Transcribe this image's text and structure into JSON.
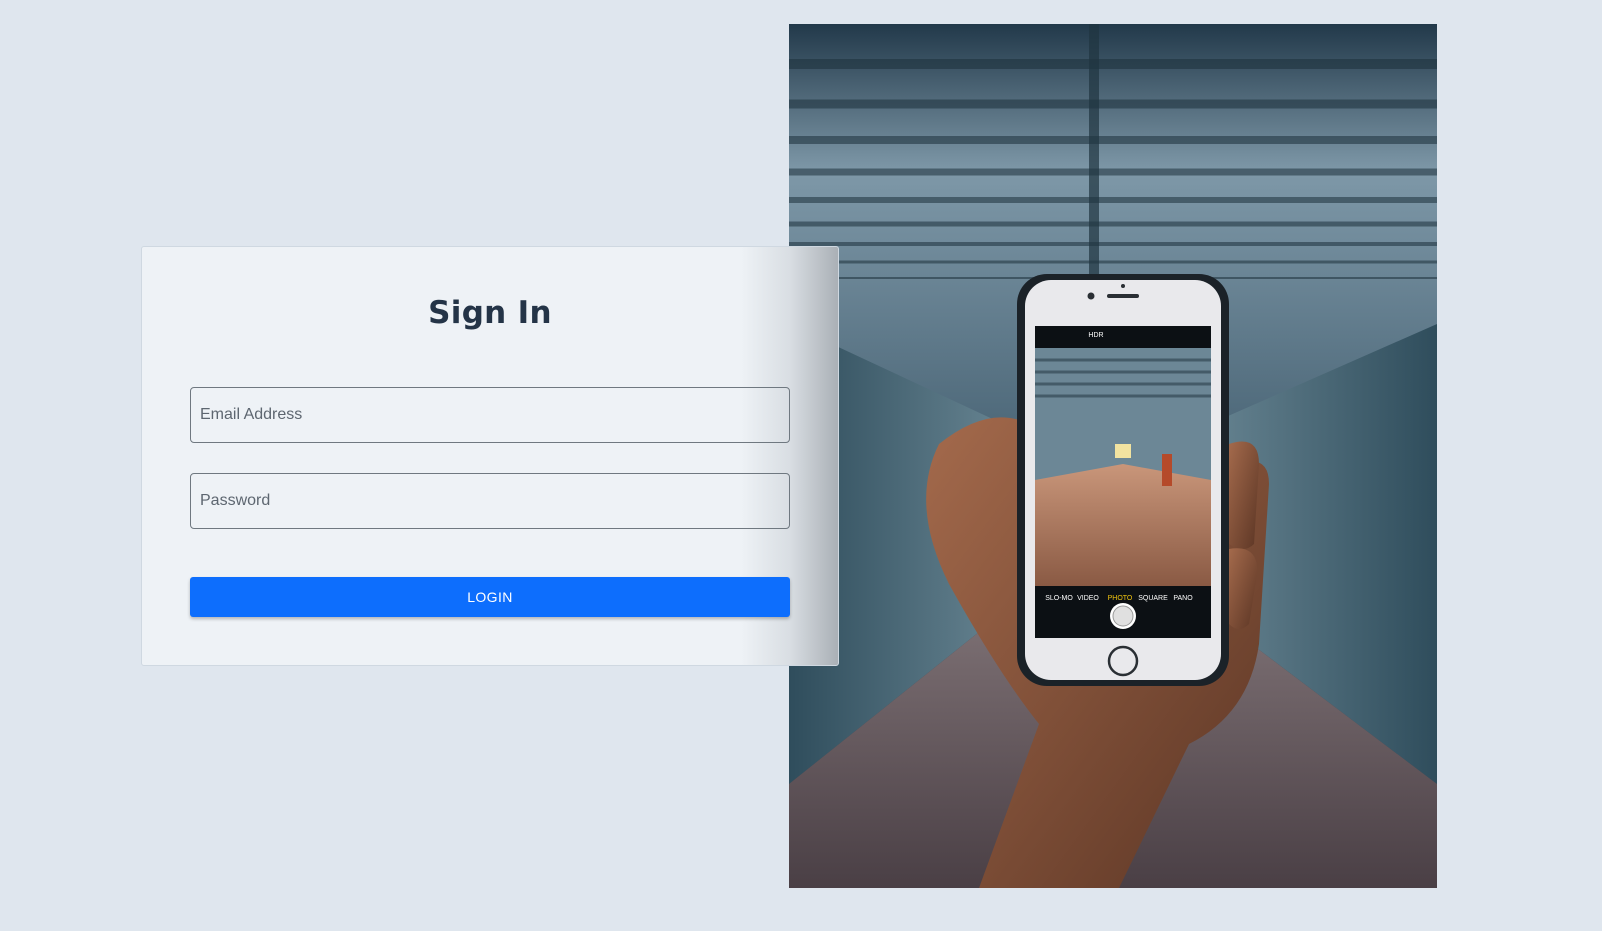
{
  "login": {
    "title": "Sign In",
    "email_placeholder": "Email Address",
    "password_placeholder": "Password",
    "login_label": "LOGIN"
  },
  "colors": {
    "background": "#dfe6ee",
    "card": "#eef2f6",
    "title": "#243447",
    "primary_button": "#0d6efd"
  },
  "photo": {
    "camera_modes": [
      "SLO-MO",
      "VIDEO",
      "PHOTO",
      "SQUARE",
      "PANO"
    ],
    "camera_top": "HDR"
  }
}
